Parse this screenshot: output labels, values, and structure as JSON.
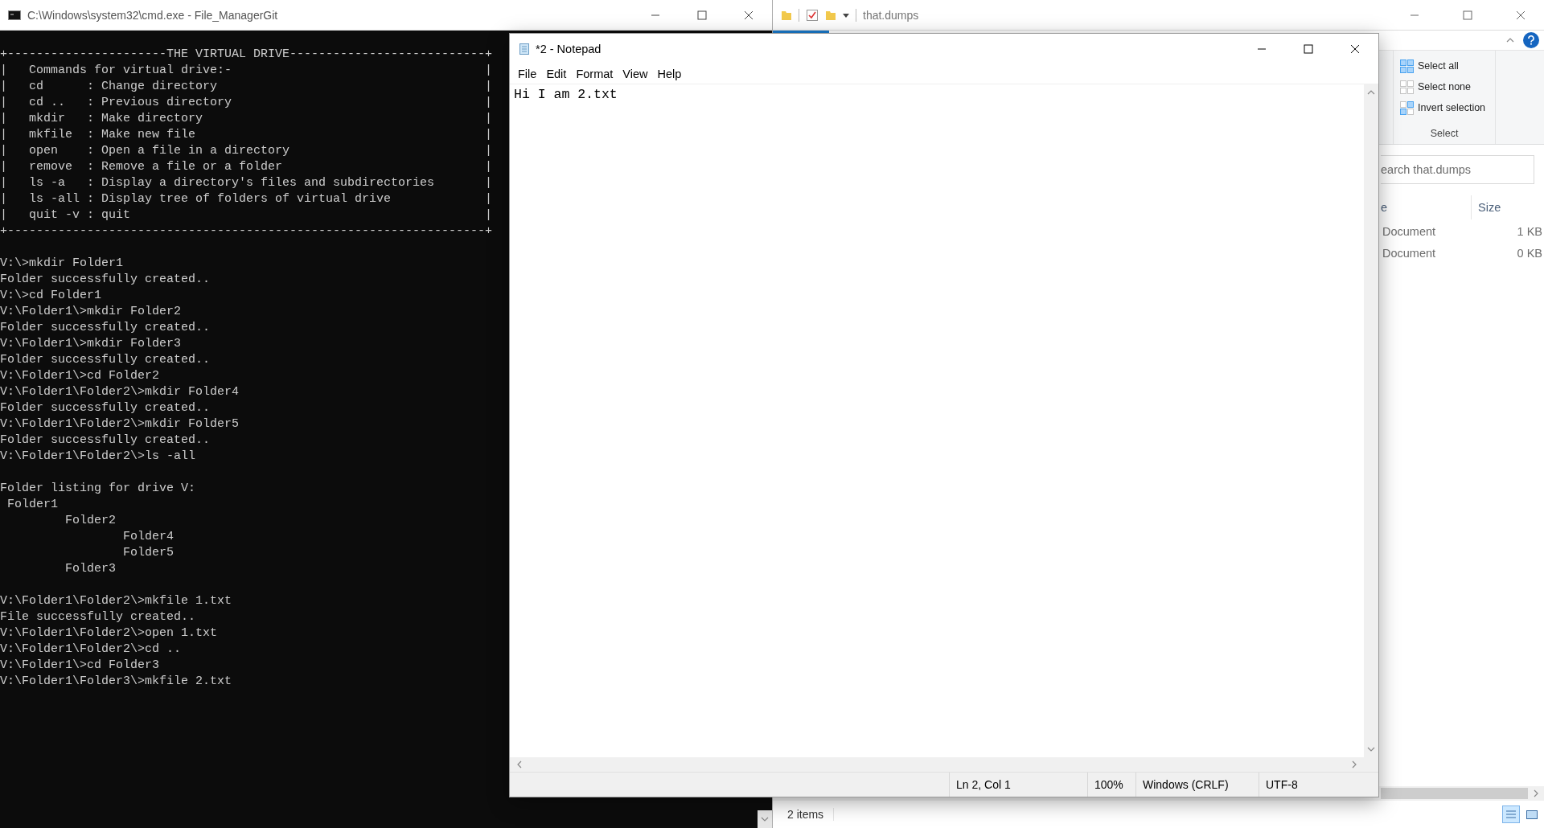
{
  "cmd_window": {
    "title": "C:\\Windows\\system32\\cmd.exe - File_ManagerGit",
    "header_box": {
      "top": "+----------------------THE VIRTUAL DRIVE---------------------------+",
      "rows": [
        {
          "text": "|   Commands for virtual drive:-",
          "edge": "|"
        },
        {
          "text": "|   cd      : Change directory",
          "edge": "|"
        },
        {
          "text": "|   cd ..   : Previous directory",
          "edge": "|"
        },
        {
          "text": "|   mkdir   : Make directory",
          "edge": "|"
        },
        {
          "text": "|   mkfile  : Make new file",
          "edge": "|"
        },
        {
          "text": "|   open    : Open a file in a directory",
          "edge": "|"
        },
        {
          "text": "|   remove  : Remove a file or a folder",
          "edge": "|"
        },
        {
          "text": "|   ls -a   : Display a directory's files and subdirectories",
          "edge": "|"
        },
        {
          "text": "|   ls -all : Display tree of folders of virtual drive",
          "edge": "|"
        },
        {
          "text": "|   quit -v : quit",
          "edge": "|"
        }
      ],
      "bottom": "+------------------------------------------------------------------+"
    },
    "session": [
      "V:\\>mkdir Folder1",
      "Folder successfully created..",
      "V:\\>cd Folder1",
      "V:\\Folder1\\>mkdir Folder2",
      "Folder successfully created..",
      "V:\\Folder1\\>mkdir Folder3",
      "Folder successfully created..",
      "V:\\Folder1\\>cd Folder2",
      "V:\\Folder1\\Folder2\\>mkdir Folder4",
      "Folder successfully created..",
      "V:\\Folder1\\Folder2\\>mkdir Folder5",
      "Folder successfully created..",
      "V:\\Folder1\\Folder2\\>ls -all"
    ],
    "listing": {
      "title": "Folder listing for drive V:",
      "tree": [
        {
          "name": "Folder1",
          "children": [
            {
              "name": "Folder2",
              "children": [
                {
                  "name": "Folder4"
                },
                {
                  "name": "Folder5"
                }
              ]
            },
            {
              "name": "Folder3"
            }
          ]
        }
      ]
    },
    "session_2": [
      "V:\\Folder1\\Folder2\\>mkfile 1.txt",
      "File successfully created..",
      "V:\\Folder1\\Folder2\\>open 1.txt",
      "V:\\Folder1\\Folder2\\>cd ..",
      "V:\\Folder1\\>cd Folder3",
      "V:\\Folder1\\Folder3\\>mkfile 2.txt"
    ]
  },
  "explorer_window": {
    "title": "that.dumps",
    "ribbon": {
      "group_label": "Select",
      "commands": [
        {
          "label": "Select all",
          "kind": "all"
        },
        {
          "label": "Select none",
          "kind": "none"
        },
        {
          "label": "Invert selection",
          "kind": "invert"
        }
      ]
    },
    "search": {
      "placeholder": "earch that.dumps"
    },
    "columns": [
      {
        "label": "e"
      },
      {
        "label": "Size"
      }
    ],
    "rows": [
      {
        "type": "Document",
        "size": "1 KB"
      },
      {
        "type": "Document",
        "size": "0 KB"
      }
    ],
    "status": "2 items",
    "views": [
      {
        "kind": "details",
        "selected": true
      },
      {
        "kind": "tiles",
        "selected": false
      }
    ]
  },
  "notepad": {
    "title": "*2 - Notepad",
    "menu": [
      "File",
      "Edit",
      "Format",
      "View",
      "Help"
    ],
    "text": "Hi I am 2.txt",
    "status": [
      "Ln 2, Col 1",
      "100%",
      "Windows (CRLF)",
      "UTF-8"
    ]
  }
}
